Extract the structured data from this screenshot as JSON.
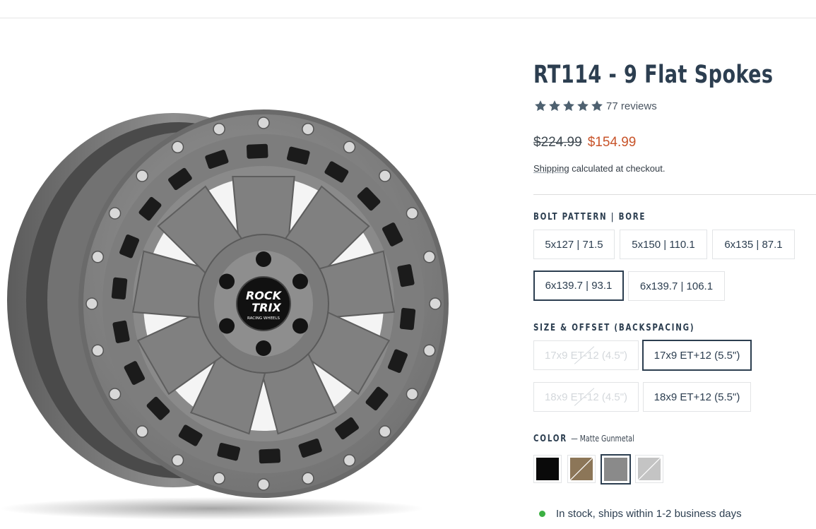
{
  "product": {
    "title": "RT114 - 9 Flat Spokes",
    "rating": 5,
    "reviews_text": "77 reviews",
    "compare_price": "$224.99",
    "sale_price": "$154.99",
    "shipping_link": "Shipping",
    "shipping_rest": " calculated at checkout.",
    "image_logo": {
      "line1": "ROCK",
      "line2": "TRIX",
      "line3": "RACING WHEELS"
    }
  },
  "bolt_pattern": {
    "label": "BOLT PATTERN | BORE",
    "options": [
      {
        "label": "5x127 | 71.5",
        "selected": false,
        "available": true
      },
      {
        "label": "5x150 | 110.1",
        "selected": false,
        "available": true
      },
      {
        "label": "6x135 | 87.1",
        "selected": false,
        "available": true
      },
      {
        "label": "6x139.7 | 93.1",
        "selected": true,
        "available": true
      },
      {
        "label": "6x139.7 | 106.1",
        "selected": false,
        "available": true
      }
    ]
  },
  "size_offset": {
    "label": "SIZE & OFFSET (BACKSPACING)",
    "options": [
      {
        "label": "17x9 ET-12 (4.5\")",
        "selected": false,
        "available": false
      },
      {
        "label": "17x9 ET+12 (5.5\")",
        "selected": true,
        "available": true
      },
      {
        "label": "18x9 ET-12 (4.5\")",
        "selected": false,
        "available": false
      },
      {
        "label": "18x9 ET+12 (5.5\")",
        "selected": false,
        "available": true
      }
    ]
  },
  "color": {
    "label": "COLOR",
    "selected_name": "— Matte Gunmetal",
    "swatches": [
      {
        "name": "black",
        "hex": "#0a0a0a",
        "selected": false,
        "available": true
      },
      {
        "name": "bronze",
        "hex": "#8c7658",
        "selected": false,
        "available": false
      },
      {
        "name": "gunmetal",
        "hex": "#8a8a8a",
        "selected": true,
        "available": true
      },
      {
        "name": "silver",
        "hex": "#c4c4c4",
        "selected": false,
        "available": false
      }
    ]
  },
  "stock": {
    "text": "In stock, ships within 1-2 business days",
    "status_color": "#3cb043"
  },
  "colors": {
    "accent": "#2c3e50",
    "sale": "#c8542a",
    "border": "#e2e4e6"
  }
}
